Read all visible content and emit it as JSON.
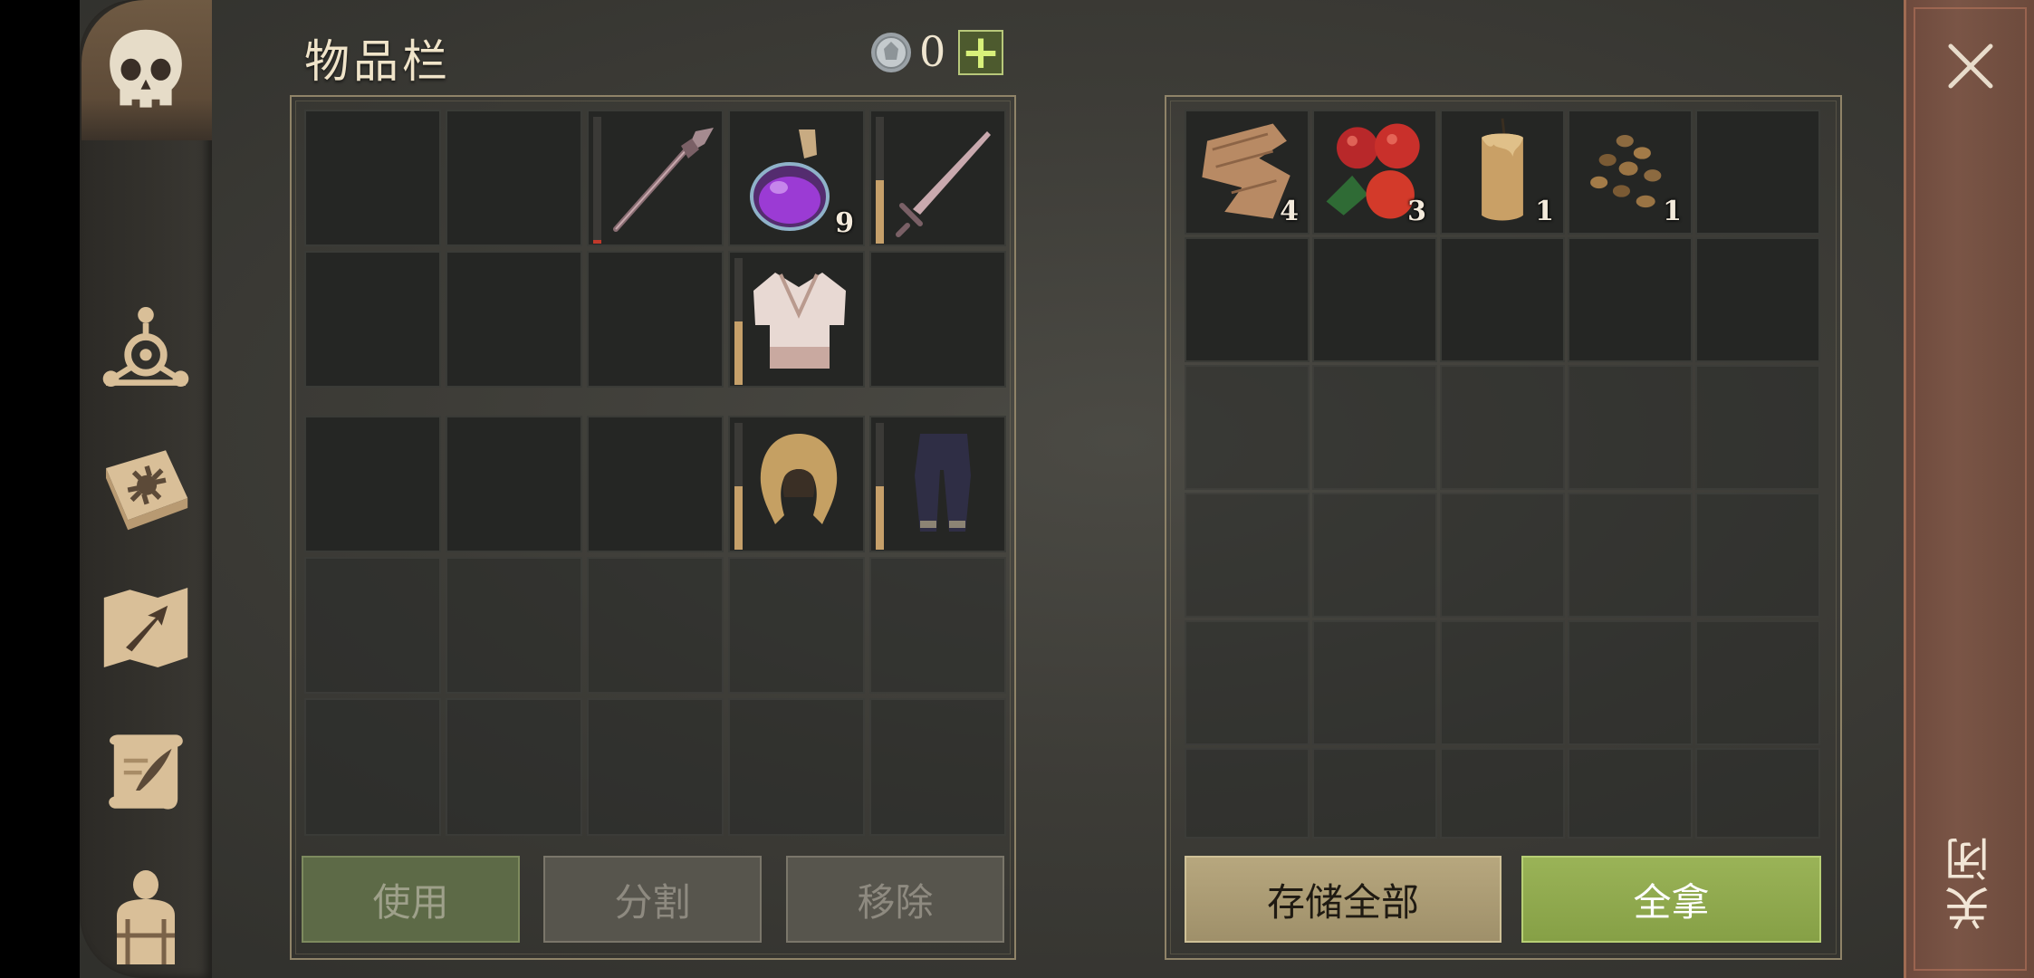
{
  "inventory": {
    "title": "物品栏",
    "coins": "0",
    "add_coin_label": "+",
    "equipped_rows": [
      [
        {
          "name": "empty"
        },
        {
          "name": "empty"
        },
        {
          "name": "spear-icon",
          "durability": 0.03
        },
        {
          "name": "potion-icon",
          "qty": "9"
        },
        {
          "name": "sword-icon",
          "durability": 0.5
        }
      ],
      [
        {
          "name": "empty"
        },
        {
          "name": "empty"
        },
        {
          "name": "empty"
        },
        {
          "name": "tunic-icon",
          "durability": 0.5
        },
        {
          "name": "empty"
        }
      ]
    ],
    "armor_row": [
      {
        "name": "empty"
      },
      {
        "name": "empty"
      },
      {
        "name": "empty"
      },
      {
        "name": "hood-icon",
        "durability": 0.5
      },
      {
        "name": "pants-icon",
        "durability": 0.5
      }
    ]
  },
  "buttons": {
    "use": "使用",
    "split": "分割",
    "remove": "移除",
    "store_all": "存储全部",
    "take_all": "全拿",
    "close": "关闭"
  },
  "loot": {
    "items": [
      {
        "name": "cloth-scraps-icon",
        "qty": "4"
      },
      {
        "name": "berries-icon",
        "qty": "3"
      },
      {
        "name": "candle-icon",
        "qty": "1"
      },
      {
        "name": "seeds-icon",
        "qty": "1"
      }
    ]
  },
  "colors": {
    "accent_green": "#9ab357",
    "durability": "#c6a06a",
    "durability_low": "#c0392b",
    "close_panel": "#7a5546"
  }
}
